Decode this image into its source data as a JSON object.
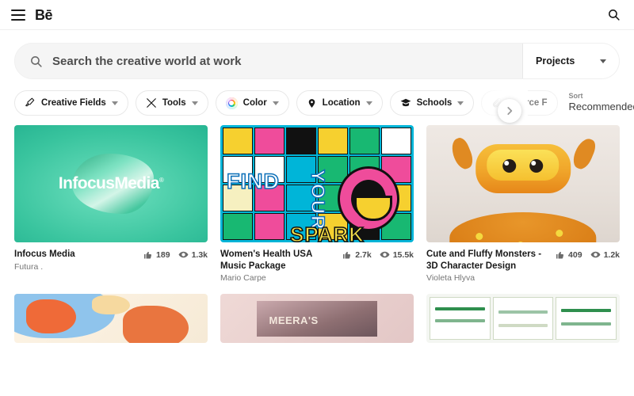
{
  "header": {
    "menu_icon": "hamburger-menu-icon",
    "logo_text": "Bē",
    "search_icon": "search-icon"
  },
  "search": {
    "placeholder": "Search the creative world at work",
    "value": "",
    "icon": "search-icon",
    "scope_label": "Projects",
    "scope_caret": "chevron-down-icon"
  },
  "filters": {
    "pills": [
      {
        "label": "Creative Fields",
        "icon": "creative-fields-icon"
      },
      {
        "label": "Tools",
        "icon": "tools-icon"
      },
      {
        "label": "Color",
        "icon": "color-wheel-icon"
      },
      {
        "label": "Location",
        "icon": "location-pin-icon"
      },
      {
        "label": "Schools",
        "icon": "graduation-cap-icon"
      },
      {
        "label": "Source F",
        "icon": "paperclip-icon"
      }
    ],
    "scroll_next_icon": "chevron-right-icon",
    "sort": {
      "title": "Sort",
      "value": "Recommended",
      "caret": "chevron-down-icon"
    }
  },
  "grid": {
    "like_icon": "thumbs-up-icon",
    "view_icon": "eye-icon",
    "cards": [
      {
        "title": "Infocus Media",
        "owner": "Futura .",
        "likes": "189",
        "views": "1.3k",
        "thumb_overlay_text": "InfocusMedia",
        "thumb_overlay_mark": "®",
        "thumb_name": "infocus-media-thumbnail"
      },
      {
        "title": "Women's Health USA Music Package",
        "owner": "Mario Carpe",
        "likes": "2.7k",
        "views": "15.5k",
        "thumb_words": [
          "FIND",
          "YOUR",
          "SPARK"
        ],
        "thumb_name": "womens-health-usa-thumbnail"
      },
      {
        "title": "Cute and Fluffy Monsters - 3D Character Design",
        "owner": "Violeta Hlyva",
        "likes": "409",
        "views": "1.2k",
        "thumb_name": "fluffy-monsters-thumbnail"
      }
    ],
    "row2_cards": [
      {
        "thumb_name": "kids-illustration-thumbnail"
      },
      {
        "thumb_name": "meera-flowers-thumbnail",
        "thumb_words": "MEERA'S"
      },
      {
        "thumb_name": "market-poster-thumbnail"
      }
    ]
  },
  "colors": {
    "accent": "#0057ff",
    "text": "#191919",
    "muted": "#767676",
    "field_bg": "#f5f5f5"
  }
}
